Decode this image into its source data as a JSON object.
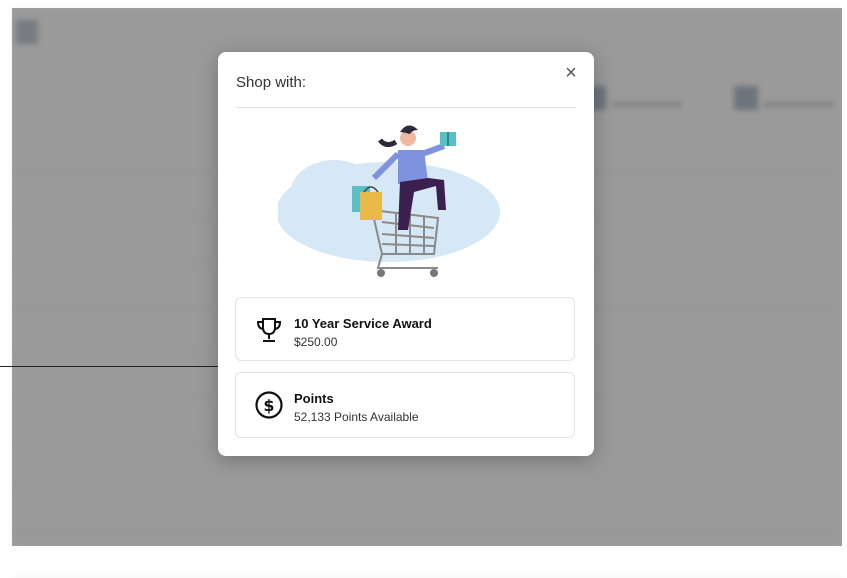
{
  "modal": {
    "title": "Shop with:",
    "close_label": "×",
    "options": [
      {
        "name": "10 Year Service Award",
        "detail": "$250.00",
        "icon": "trophy-icon"
      },
      {
        "name": "Points",
        "detail": "52,133 Points Available",
        "icon": "dollar-coin-icon"
      }
    ]
  },
  "colors": {
    "overlay": "#5a5a5a",
    "illustration_blob": "#d6e7f5",
    "shirt": "#7e92e0",
    "pants": "#3b1f4e",
    "gift": "#5bbfc6",
    "bag": "#e9b94a"
  }
}
